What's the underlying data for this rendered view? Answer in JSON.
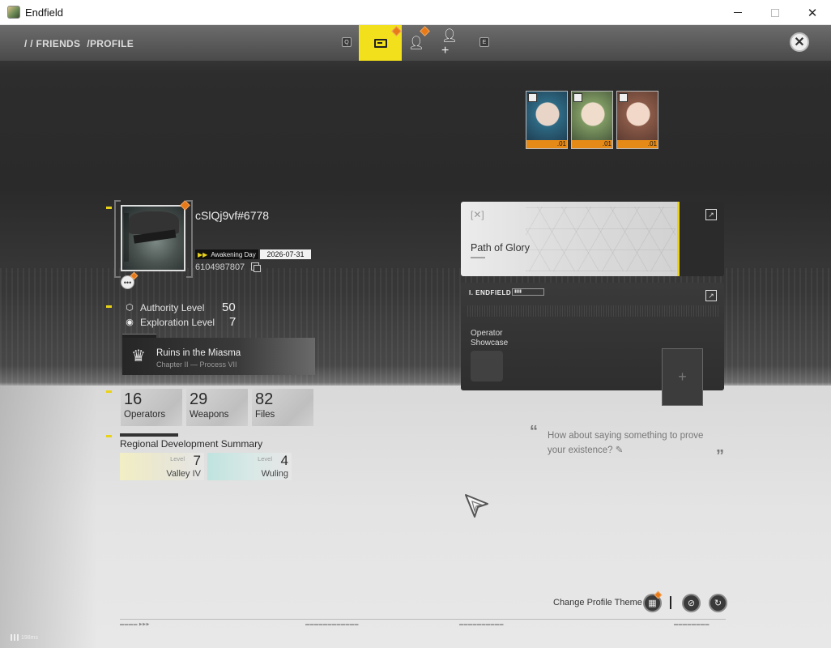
{
  "window": {
    "title": "Endfield"
  },
  "nav": {
    "breadcrumb": [
      "/ / FRIENDS",
      "/PROFILE"
    ],
    "left_key": "Q",
    "right_key": "E"
  },
  "profile": {
    "player_name": "cSlQj9vf#6778",
    "awakening_label": "Awakening Day",
    "awakening_date": "2026-07-31",
    "uid": "6104987807",
    "authority_label": "Authority Level",
    "authority_value": "50",
    "exploration_label": "Exploration Level",
    "exploration_value": "7",
    "mission_title": "Ruins in the Miasma",
    "mission_sub": "Chapter II — Process VII"
  },
  "stats": [
    {
      "value": "16",
      "label": "Operators"
    },
    {
      "value": "29",
      "label": "Weapons"
    },
    {
      "value": "82",
      "label": "Files"
    }
  ],
  "regional": {
    "title": "Regional Development Summary",
    "regions": [
      {
        "level_label": "Level",
        "level": "7",
        "name": "Valley IV"
      },
      {
        "level_label": "Level",
        "level": "4",
        "name": "Wuling"
      }
    ]
  },
  "glory_card": {
    "title": "Path of Glory"
  },
  "showcase": {
    "header": "I. ENDFIELD",
    "label_line1": "Operator",
    "label_line2": "Showcase",
    "operators": [
      {
        "level": ".01",
        "palette": "#2f6a84"
      },
      {
        "level": ".01",
        "palette": "#7f9a63"
      },
      {
        "level": ".01",
        "palette": "#8a5a48"
      }
    ]
  },
  "quote": {
    "text": "How about saying something to prove your existence?"
  },
  "footer": {
    "theme_label": "Change Profile Theme",
    "ping": "198ms"
  },
  "colors": {
    "accent": "#f1e01b",
    "badge": "#e87a17"
  }
}
